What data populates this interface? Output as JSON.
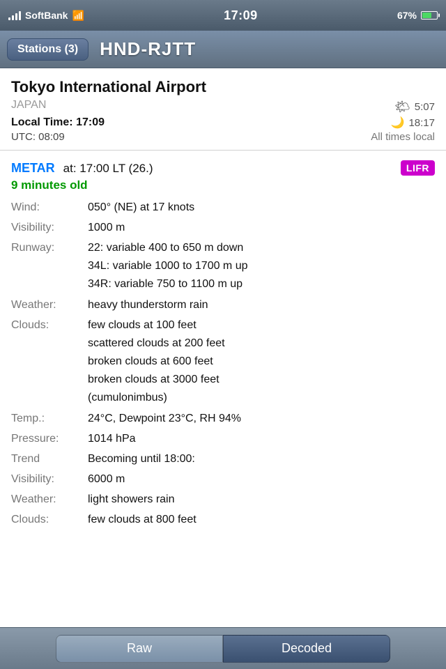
{
  "statusBar": {
    "carrier": "SoftBank",
    "time": "17:09",
    "battery": "67%"
  },
  "navBar": {
    "backButton": "Stations (3)",
    "title": "HND-RJTT"
  },
  "airport": {
    "name": "Tokyo International Airport",
    "country": "JAPAN",
    "sunriseTime": "5:07",
    "sunsetTime": "18:17",
    "localTimeLabel": "Local Time:",
    "localTime": "17:09",
    "utcLabel": "UTC:",
    "utcTime": "08:09",
    "allTimesNote": "All times local"
  },
  "metar": {
    "label": "METAR",
    "atTime": "at: 17:00 LT (26.)",
    "badge": "LIFR",
    "age": "9 minutes old",
    "wind": {
      "label": "Wind:",
      "value": "050° (NE) at 17 knots"
    },
    "visibility": {
      "label": "Visibility:",
      "value": "1000 m"
    },
    "runway": {
      "label": "Runway:",
      "lines": [
        "22: variable 400 to 650 m down",
        "34L: variable 1000 to 1700 m up",
        "34R: variable 750 to 1100 m up"
      ]
    },
    "weather": {
      "label": "Weather:",
      "value": "heavy thunderstorm rain"
    },
    "clouds": {
      "label": "Clouds:",
      "lines": [
        "few clouds at 100 feet",
        "scattered clouds at 200 feet",
        "broken clouds at 600 feet",
        "broken clouds at 3000 feet",
        "(cumulonimbus)"
      ]
    },
    "temp": {
      "label": "Temp.:",
      "value": "24°C, Dewpoint 23°C, RH 94%"
    },
    "pressure": {
      "label": "Pressure:",
      "value": "1014 hPa"
    },
    "trend": {
      "label": "Trend",
      "value": "Becoming until 18:00:"
    },
    "visibilityTrend": {
      "label": "Visibility:",
      "value": "6000 m"
    },
    "weatherTrend": {
      "label": "Weather:",
      "value": "light showers rain"
    },
    "cloudsPartial": {
      "label": "Clouds:",
      "value": "few clouds at 800 feet"
    }
  },
  "tabBar": {
    "rawLabel": "Raw",
    "decodedLabel": "Decoded"
  }
}
